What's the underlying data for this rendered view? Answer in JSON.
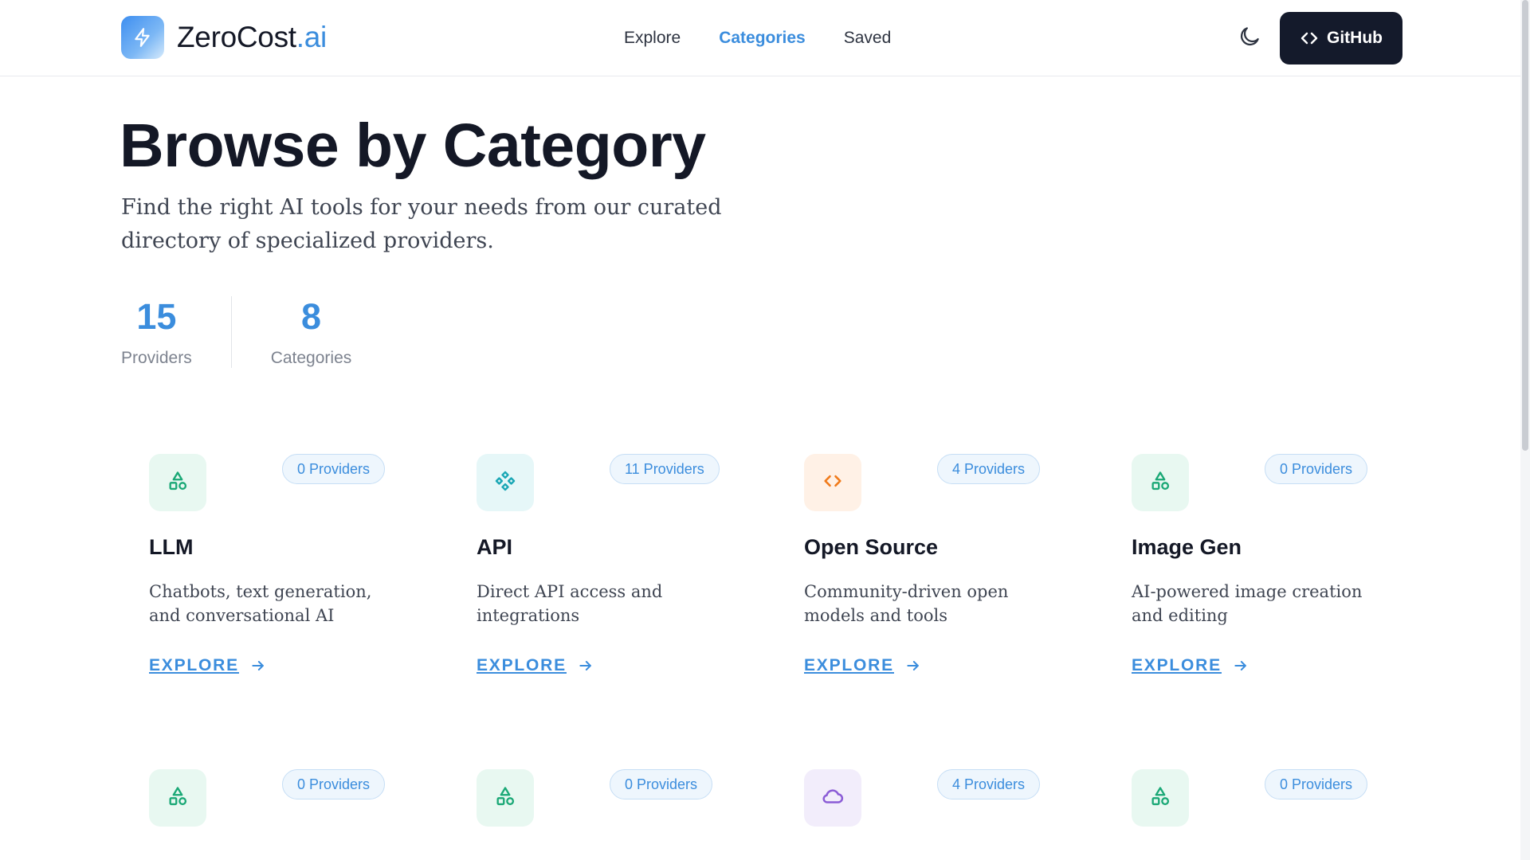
{
  "brand": {
    "name_main": "ZeroCost",
    "name_accent": ".ai",
    "accent_color": "#3b8ddd",
    "logo_icon": "lightning-icon"
  },
  "nav": {
    "items": [
      {
        "label": "Explore",
        "active": false
      },
      {
        "label": "Categories",
        "active": true
      },
      {
        "label": "Saved",
        "active": false
      }
    ],
    "theme_toggle_icon": "moon-icon",
    "github_label": "GitHub",
    "github_icon": "code-icon"
  },
  "hero": {
    "title": "Browse by Category",
    "subtitle": "Find the right AI tools for your needs from our curated directory of specialized providers."
  },
  "stats": [
    {
      "value": "15",
      "label": "Providers"
    },
    {
      "value": "8",
      "label": "Categories"
    }
  ],
  "categories": [
    {
      "title": "LLM",
      "badge": "0 Providers",
      "description": "Chatbots, text generation, and conversational AI",
      "link": "EXPLORE",
      "icon": "shapes-icon",
      "icon_bg": "#e8f8f1",
      "icon_color": "#1aa876"
    },
    {
      "title": "API",
      "badge": "11 Providers",
      "description": "Direct API access and integrations",
      "link": "EXPLORE",
      "icon": "component-icon",
      "icon_bg": "#e6f7f8",
      "icon_color": "#1aa7b5"
    },
    {
      "title": "Open Source",
      "badge": "4 Providers",
      "description": "Community-driven open models and tools",
      "link": "EXPLORE",
      "icon": "code-icon",
      "icon_bg": "#fff1e6",
      "icon_color": "#f07a1a"
    },
    {
      "title": "Image Gen",
      "badge": "0 Providers",
      "description": "AI-powered image creation and editing",
      "link": "EXPLORE",
      "icon": "shapes-icon",
      "icon_bg": "#e8f8f1",
      "icon_color": "#1aa876"
    },
    {
      "badge": "0 Providers",
      "icon": "shapes-icon",
      "icon_bg": "#e8f8f1",
      "icon_color": "#1aa876"
    },
    {
      "badge": "0 Providers",
      "icon": "shapes-icon",
      "icon_bg": "#e8f8f1",
      "icon_color": "#1aa876"
    },
    {
      "badge": "4 Providers",
      "icon": "cloud-icon",
      "icon_bg": "#f2edfb",
      "icon_color": "#8b5cd6"
    },
    {
      "badge": "0 Providers",
      "icon": "shapes-icon",
      "icon_bg": "#e8f8f1",
      "icon_color": "#1aa876"
    }
  ]
}
